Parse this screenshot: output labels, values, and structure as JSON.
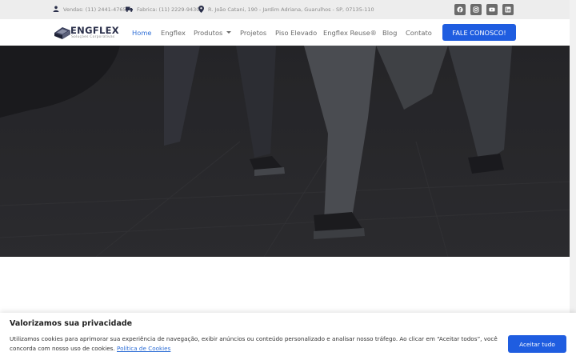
{
  "topbar": {
    "sales": "Vendas: (11) 2441-4765",
    "factory": "Fabrica: (11) 2229-9430",
    "address": "R. João Catani, 190 - Jardim Adriana, Guarulhos - SP, 07135-110",
    "social": [
      "facebook-icon",
      "instagram-icon",
      "youtube-icon",
      "linkedin-icon"
    ]
  },
  "brand": {
    "name": "ENGFLEX",
    "tagline": "Soluções Corporativas"
  },
  "nav": {
    "items": [
      "Home",
      "Engflex",
      "Produtos",
      "Projetos",
      "Piso Elevado",
      "Engflex Reuse®",
      "Blog",
      "Contato"
    ],
    "active": "Home",
    "cta": "FALE CONOSCO!"
  },
  "cookie": {
    "title": "Valorizamos sua privacidade",
    "text": "Utilizamos cookies para aprimorar sua experiência de navegação, exibir anúncios ou conteúdo personalizado e analisar nosso tráfego. Ao clicar em “Aceitar todos”, você concorda com nosso uso de cookies.",
    "link": "Política de Cookies",
    "accept": "Aceitar tudo"
  },
  "colors": {
    "accent": "#1f5de0",
    "active_link": "#2f6fd6",
    "topbar_bg": "#ededed",
    "brand_dark": "#2a2f4a"
  }
}
